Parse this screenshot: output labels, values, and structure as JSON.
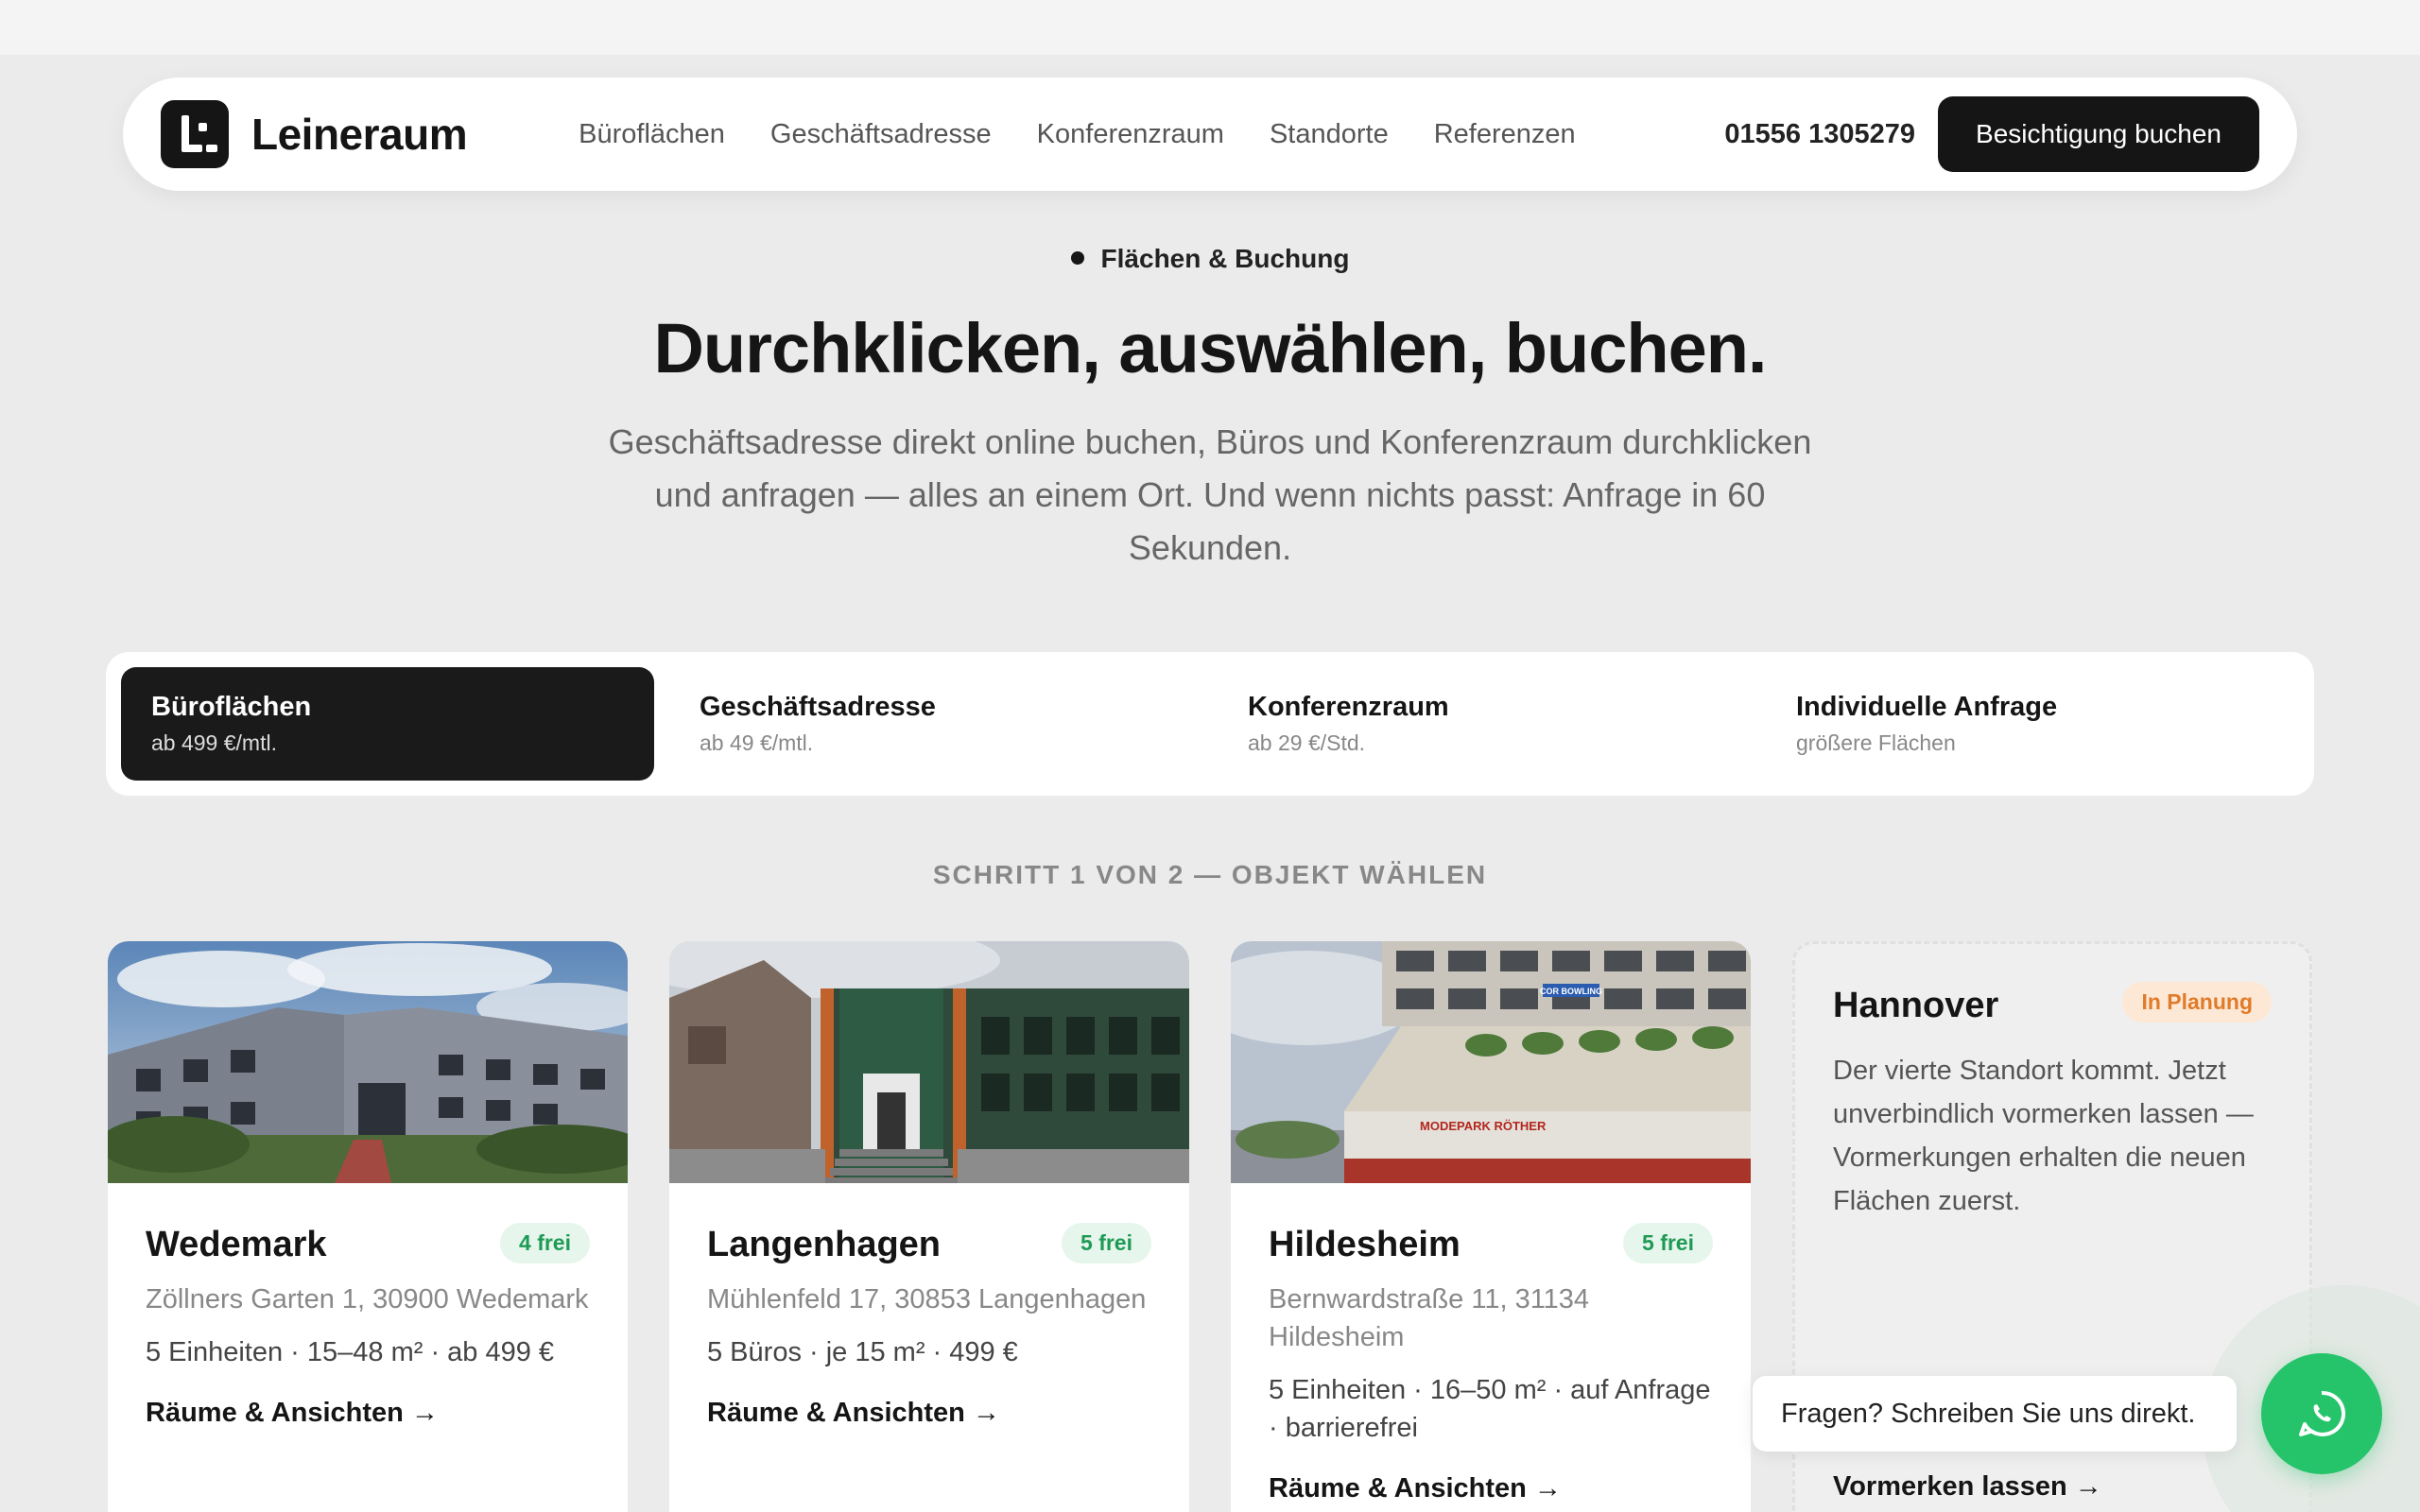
{
  "header": {
    "brand": "Leineraum",
    "nav": [
      "Büroflächen",
      "Geschäftsadresse",
      "Konferenzraum",
      "Standorte",
      "Referenzen"
    ],
    "phone": "01556 1305279",
    "cta": "Besichtigung buchen"
  },
  "hero": {
    "eyebrow": "Flächen & Buchung",
    "title": "Durchklicken, auswählen, buchen.",
    "subtitle": "Geschäftsadresse direkt online buchen, Büros und Konferenzraum durchklicken und anfragen — alles an einem Ort. Und wenn nichts passt: Anfrage in 60 Sekunden."
  },
  "tabs": [
    {
      "label": "Büroflächen",
      "sub": "ab 499 €/mtl.",
      "active": true
    },
    {
      "label": "Geschäftsadresse",
      "sub": "ab 49 €/mtl.",
      "active": false
    },
    {
      "label": "Konferenzraum",
      "sub": "ab 29 €/Std.",
      "active": false
    },
    {
      "label": "Individuelle Anfrage",
      "sub": "größere Flächen",
      "active": false
    }
  ],
  "step_label": "SCHRITT 1 VON 2 — OBJEKT WÄHLEN",
  "locations": [
    {
      "name": "Wedemark",
      "badge": "4 frei",
      "address": "Zöllners Garten 1, 30900 Wedemark",
      "meta": "5 Einheiten · 15–48 m² · ab 499 €",
      "link": "Räume & Ansichten →"
    },
    {
      "name": "Langenhagen",
      "badge": "5 frei",
      "address": "Mühlenfeld 17, 30853 Langenhagen",
      "meta": "5 Büros · je 15 m² · 499 €",
      "link": "Räume & Ansichten →"
    },
    {
      "name": "Hildesheim",
      "badge": "5 frei",
      "address": "Bernwardstraße 11, 31134 Hildesheim",
      "meta": "5 Einheiten · 16–50 m² · auf Anfrage · barrierefrei",
      "link": "Räume & Ansichten →",
      "sign_text_1": "MODEPARK RÖTHER",
      "sign_text_2": "COR BOWLING"
    }
  ],
  "planned": {
    "name": "Hannover",
    "badge": "In Planung",
    "text": "Der vierte Standort kommt. Jetzt unverbindlich vormerken lassen — Vormerkungen erhalten die neuen Flächen zuerst.",
    "link": "Vormerken lassen →"
  },
  "chat": {
    "bubble": "Fragen? Schreiben Sie uns direkt.",
    "icon": "whatsapp-icon"
  },
  "colors": {
    "accent": "#151515",
    "free_badge": "#1e9a55",
    "planning_badge": "#e07b2a",
    "chat": "#25c46a"
  }
}
